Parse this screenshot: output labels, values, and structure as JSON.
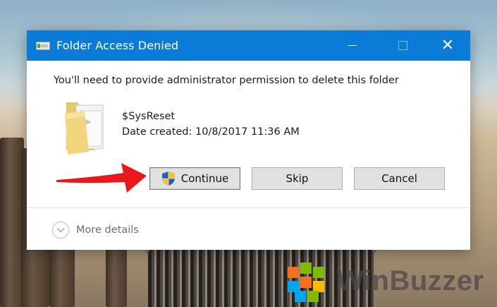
{
  "dialog": {
    "title": "Folder Access Denied",
    "message": "You'll need to provide administrator permission to delete this folder",
    "item": {
      "name": "$SysReset",
      "date_created": "Date created: 10/8/2017 11:36 AM"
    },
    "buttons": {
      "continue": "Continue",
      "skip": "Skip",
      "cancel": "Cancel"
    },
    "more_details": "More details",
    "accent_color": "#0a7bd7"
  },
  "watermark": {
    "brand": "WinBuzzer"
  },
  "annotation": {
    "arrow_color": "#e8191b"
  }
}
